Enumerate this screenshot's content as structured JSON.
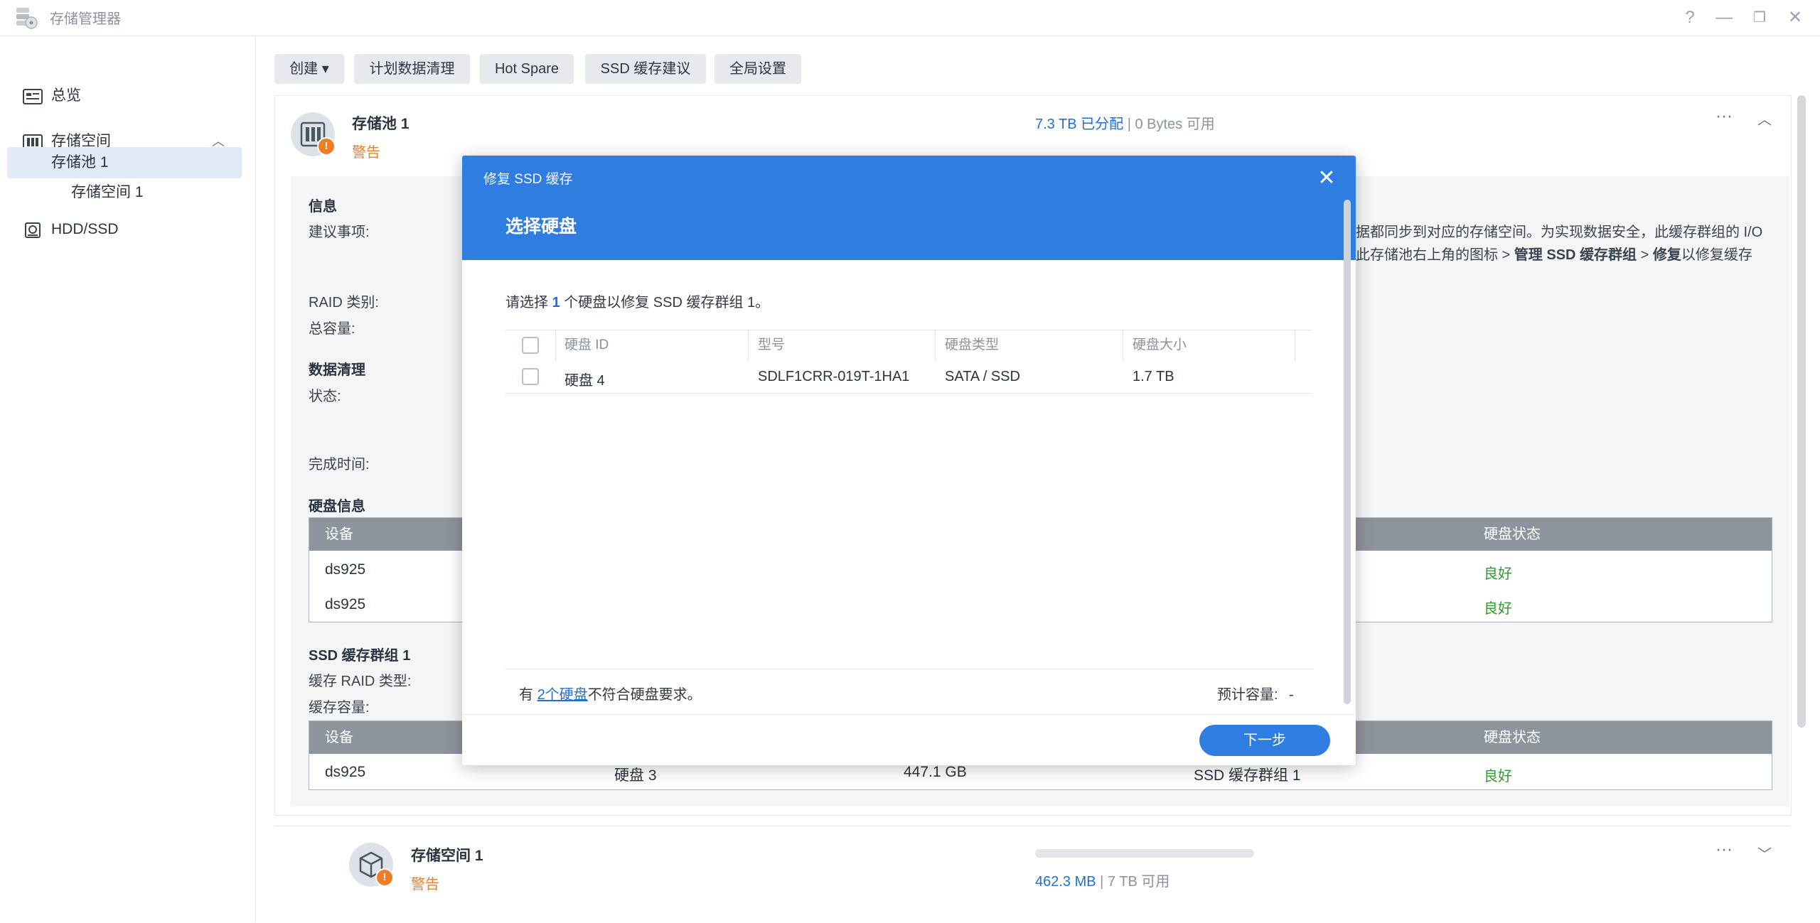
{
  "window": {
    "title": "存储管理器",
    "help": "?",
    "minimize": "—",
    "restore": "❐",
    "close": "✕"
  },
  "sidebar": {
    "items": [
      {
        "label": "总览"
      },
      {
        "label": "存储空间"
      },
      {
        "label": "存储池 1"
      },
      {
        "label": "存储空间 1"
      },
      {
        "label": "HDD/SSD"
      }
    ]
  },
  "toolbar": {
    "create": "创建 ▾",
    "scrub": "计划数据清理",
    "hotspare": "Hot Spare",
    "ssd_advice": "SSD 缓存建议",
    "global": "全局设置"
  },
  "pool": {
    "name": "存储池 1",
    "status": "警告",
    "allocated": "7.3 TB 已分配",
    "sep": "|",
    "available": "0 Bytes 可用",
    "more": "···",
    "collapse": "︿",
    "info_title": "信息",
    "advice_label": "建议事项:",
    "advice_line1": "据都同步到对应的存储空间。为实现数据安全，此缓存群组的 I/O",
    "advice_line2_pre": "此存储池右上角的图标 > ",
    "advice_line2_b1": "管理 SSD 缓存群组",
    "advice_line2_mid": " > ",
    "advice_line2_b2": "修复",
    "advice_line2_post": "以修复缓存",
    "raid_label": "RAID 类别:",
    "capacity_label": "总容量:",
    "scrub_title": "数据清理",
    "scrub_status_label": "状态:",
    "scrub_done_label": "完成时间:",
    "disk_info_title": "硬盘信息",
    "disk_table": {
      "col_device": "设备",
      "col_status": "硬盘状态",
      "rows": [
        {
          "device": "ds925",
          "status": "良好"
        },
        {
          "device": "ds925",
          "status": "良好"
        }
      ]
    },
    "ssd_group_title": "SSD 缓存群组 1",
    "ssd_raid_label": "缓存 RAID 类型:",
    "ssd_capacity_label": "缓存容量:",
    "ssd_table": {
      "col_device": "设备",
      "col_status": "硬盘状态",
      "rows": [
        {
          "device": "ds925",
          "disk": "硬盘 3",
          "size": "447.1 GB",
          "group": "SSD 缓存群组 1",
          "status": "良好"
        }
      ]
    }
  },
  "volume": {
    "name": "存储空间 1",
    "status": "警告",
    "used": "462.3 MB",
    "sep": "|",
    "available": "7 TB 可用",
    "used_fraction": 0.0,
    "more": "···",
    "expand": "﹀"
  },
  "modal": {
    "title_small": "修复 SSD 缓存",
    "title": "选择硬盘",
    "close": "✕",
    "instr_pre": "请选择 ",
    "instr_num": "1",
    "instr_post": " 个硬盘以修复 SSD 缓存群组 1。",
    "columns": [
      "硬盘 ID",
      "型号",
      "硬盘类型",
      "硬盘大小"
    ],
    "rows": [
      {
        "id": "硬盘 4",
        "model": "SDLF1CRR-019T-1HA1",
        "type": "SATA / SSD",
        "size": "1.7 TB"
      }
    ],
    "foot_pre": "有 ",
    "foot_link": "2个硬盘",
    "foot_post": "不符合硬盘要求。",
    "est_label": "预计容量:",
    "est_value": "-",
    "next": "下一步"
  },
  "colors": {
    "accent": "#2f7de1",
    "warning": "#ee7d23",
    "good": "#2d9b2d"
  }
}
